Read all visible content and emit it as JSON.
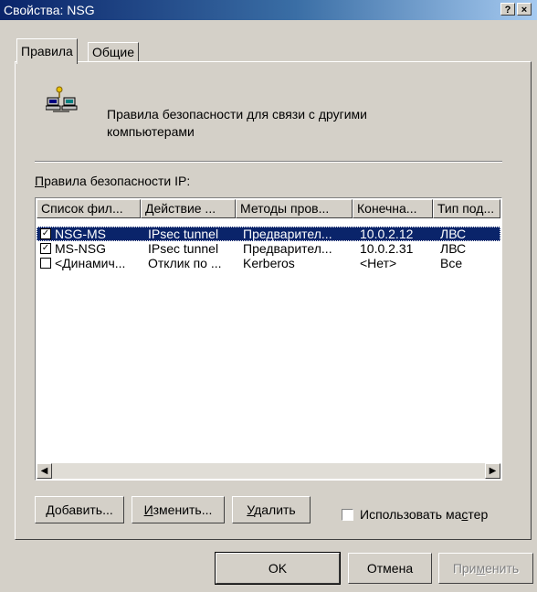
{
  "window": {
    "title": "Свойства: NSG",
    "help_label": "?",
    "close_label": "×"
  },
  "tabs": [
    {
      "label": "Правила",
      "active": true
    },
    {
      "label": "Общие",
      "active": false
    }
  ],
  "description": "Правила безопасности для связи с другими компьютерами",
  "rules_label": {
    "pre": "",
    "u": "П",
    "post": "равила безопасности IP:"
  },
  "table": {
    "columns": [
      "Список фил...",
      "Действие ...",
      "Методы пров...",
      "Конечна...",
      "Тип под..."
    ],
    "rows": [
      {
        "checked": true,
        "selected": true,
        "cells": [
          "NSG-MS",
          "IPsec tunnel",
          "Предварител...",
          "10.0.2.12",
          "ЛВС"
        ]
      },
      {
        "checked": true,
        "selected": false,
        "cells": [
          "MS-NSG",
          "IPsec tunnel",
          "Предварител...",
          "10.0.2.31",
          "ЛВС"
        ]
      },
      {
        "checked": false,
        "selected": false,
        "cells": [
          "<Динамич...",
          "Отклик по ...",
          "Kerberos",
          "<Нет>",
          "Все"
        ]
      }
    ]
  },
  "scroll": {
    "left_arrow": "◀",
    "right_arrow": "▶"
  },
  "buttons": {
    "add": {
      "pre": "",
      "u": "Д",
      "post": "обавить..."
    },
    "edit": {
      "pre": "",
      "u": "И",
      "post": "зменить..."
    },
    "delete": {
      "pre": "",
      "u": "У",
      "post": "далить"
    },
    "ok": "OK",
    "cancel": "Отмена",
    "apply": {
      "pre": "При",
      "u": "м",
      "post": "енить"
    }
  },
  "wizard_checkbox": {
    "pre": "Использовать ма",
    "u": "с",
    "post": "тер",
    "checked": false
  },
  "icon": "network-computers-icon"
}
